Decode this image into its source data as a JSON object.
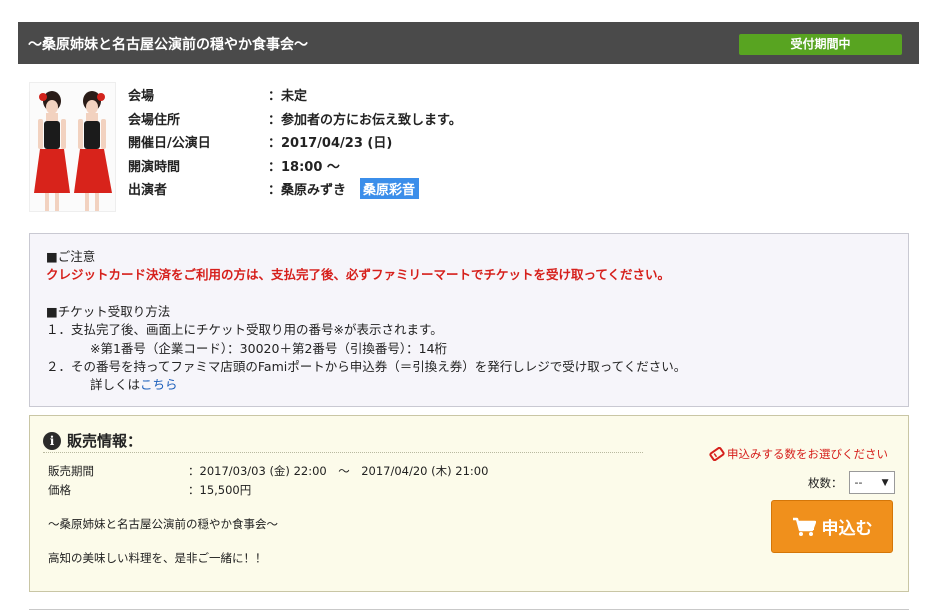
{
  "header": {
    "title": "～桑原姉妹と名古屋公演前の穏やか食事会～",
    "status": "受付期間中"
  },
  "event_info": [
    {
      "label": "会場",
      "value": "：未定"
    },
    {
      "label": "会場住所",
      "value": "：参加者の方にお伝え致します。"
    },
    {
      "label": "開催日/公演日",
      "value": "：2017/04/23 (日)"
    },
    {
      "label": "開演時間",
      "value": "：18:00 ～"
    },
    {
      "label": "出演者",
      "value": "：桑原みずき",
      "highlight": "桑原彩音"
    }
  ],
  "notice": {
    "heading": "■ご注意",
    "warning": "クレジットカード決済をご利用の方は、支払完了後、必ずファミリーマートでチケットを受け取ってください。",
    "method_heading": "■チケット受取り方法",
    "step1": "１．支払完了後、画面上にチケット受取り用の番号※が表示されます。",
    "step1_note": "※第1番号（企業コード）：30020＋第2番号（引換番号）：14桁",
    "step2": "２．その番号を持ってファミマ店頭のFamiポートから申込券（＝引換え券）を発行しレジで受け取ってください。",
    "details_prefix": "詳しくは",
    "details_link": "こちら"
  },
  "sales": {
    "title": "販売情報：",
    "period_label": "販売期間",
    "period_value": "：2017/03/03 (金) 22:00　～　2017/04/20 (木) 21:00",
    "price_label": "価格",
    "price_value": "：15,500円",
    "desc1": "～桑原姉妹と名古屋公演前の穏やか食事会～",
    "desc2": "高知の美味しい料理を、是非ご一緒に！！",
    "hint": "申込みする数をお選びください",
    "qty_label": "枚数：",
    "qty_value": "--",
    "apply_label": "申込む"
  },
  "colors": {
    "header_bg": "#4a4a4a",
    "status_green": "#58a421",
    "warning_red": "#d6201c",
    "apply_orange": "#f0901c",
    "link_blue": "#1c5fbb",
    "highlight_blue": "#3b8eea"
  },
  "icons": [
    "info-icon",
    "ticket-icon",
    "cart-icon",
    "dropdown-arrow-icon"
  ]
}
